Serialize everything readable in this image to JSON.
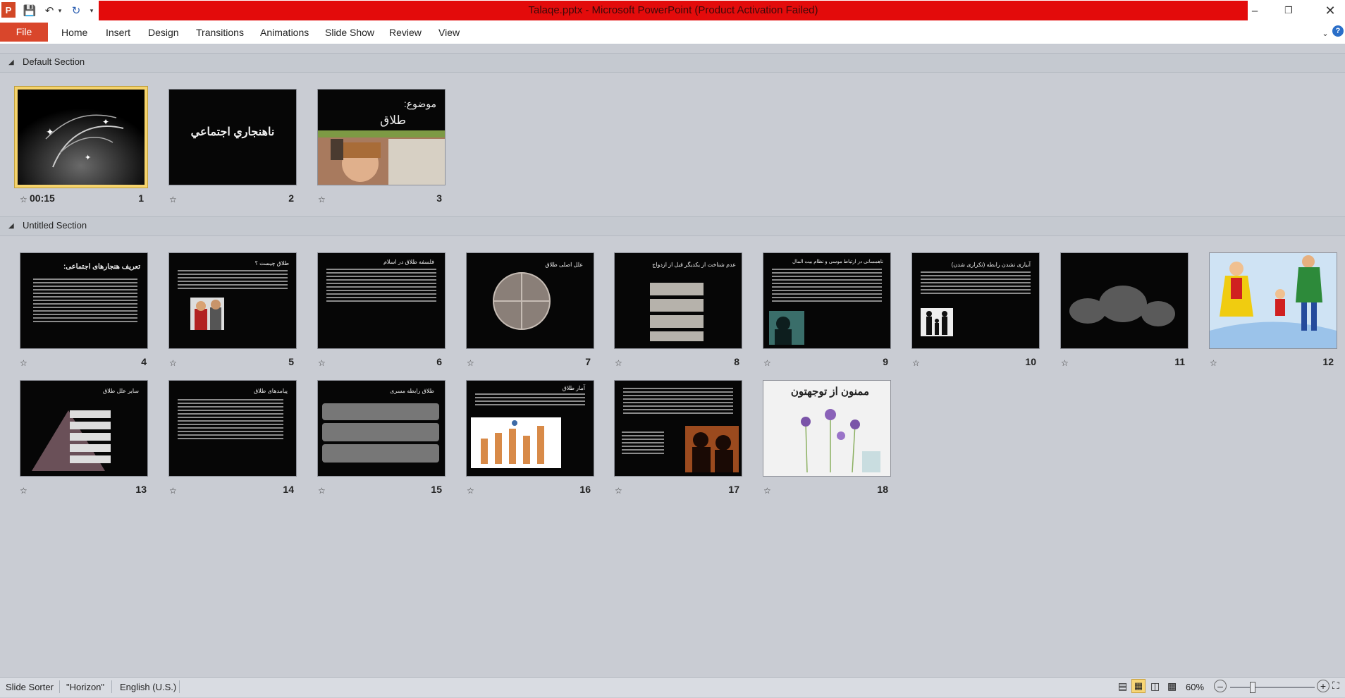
{
  "window": {
    "title": "Talaqe.pptx  -  Microsoft PowerPoint (Product Activation Failed)"
  },
  "ribbon": {
    "tabs": [
      "File",
      "Home",
      "Insert",
      "Design",
      "Transitions",
      "Animations",
      "Slide Show",
      "Review",
      "View"
    ]
  },
  "sections": [
    {
      "name": "Default Section"
    },
    {
      "name": "Untitled Section"
    }
  ],
  "slides": [
    {
      "number": "1",
      "timing": "00:15",
      "selected": true
    },
    {
      "number": "2",
      "title": "ناهنجاري اجتماعي"
    },
    {
      "number": "3",
      "title": "موضوع:",
      "subtitle": "طلاق"
    },
    {
      "number": "4",
      "title": "تعریف هنجارهای اجتماعی:"
    },
    {
      "number": "5",
      "title": "طلاق چيست ؟"
    },
    {
      "number": "6",
      "title": "فلسفه طلاق در اسلام"
    },
    {
      "number": "7",
      "title": "علل اصلی طلاق"
    },
    {
      "number": "8",
      "title": "عدم شناخت از یکدیگر قبل از ازدواج"
    },
    {
      "number": "9",
      "title": "ناهمسانی در ارتباط موسی و نظام بیت المال"
    },
    {
      "number": "10",
      "title": "آبیاری نشدن رابطه (تکراری شدن)"
    },
    {
      "number": "11"
    },
    {
      "number": "12"
    },
    {
      "number": "13",
      "title": "سایر علل طلاق"
    },
    {
      "number": "14",
      "title": "پیامدهای طلاق"
    },
    {
      "number": "15",
      "title": "طلاق رابطه مسری"
    },
    {
      "number": "16",
      "title": "آمار طلاق"
    },
    {
      "number": "17"
    },
    {
      "number": "18",
      "title": "ممنون از توجهتون"
    }
  ],
  "status": {
    "view": "Slide Sorter",
    "theme": "\"Horizon\"",
    "language": "English (U.S.)",
    "zoom": "60%",
    "zoom_level": 0.6
  },
  "colors": {
    "titlebar": "#e30b0b",
    "file_tab": "#d9462b",
    "selection": "#f5d36c"
  }
}
